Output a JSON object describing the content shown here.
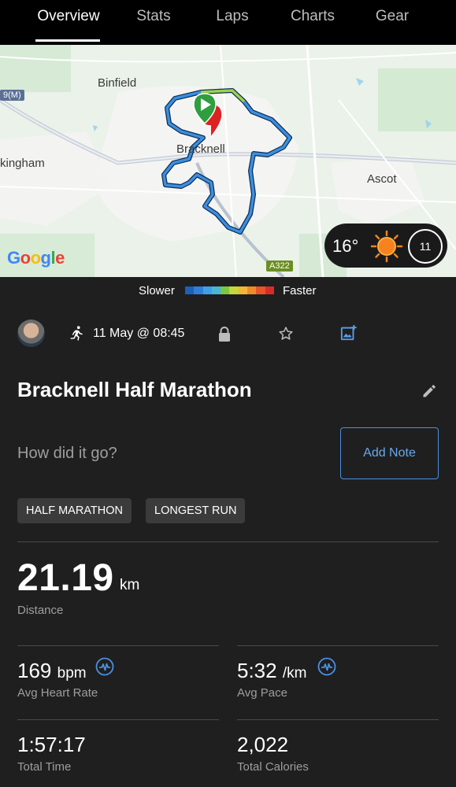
{
  "tabs": [
    {
      "label": "Overview",
      "active": true
    },
    {
      "label": "Stats",
      "active": false
    },
    {
      "label": "Laps",
      "active": false
    },
    {
      "label": "Charts",
      "active": false
    },
    {
      "label": "Gear",
      "active": false
    }
  ],
  "map": {
    "places": {
      "binfield": "Binfield",
      "bracknell": "Bracknell",
      "wokingham": "kingham",
      "ascot": "Ascot",
      "road_m": "9(M)",
      "road_a322": "A322"
    },
    "google": {
      "g": "G",
      "o1": "o",
      "o2": "o",
      "g2": "g",
      "l": "l",
      "e": "e"
    },
    "weather": {
      "temperature": "16°",
      "wind": "11",
      "condition_icon": "sun-icon"
    }
  },
  "legend": {
    "slower": "Slower",
    "faster": "Faster",
    "colors": [
      "#1e5fb8",
      "#2f7fd6",
      "#3fa0e8",
      "#48b6d8",
      "#7ac943",
      "#c8d63a",
      "#f2b736",
      "#f08a2a",
      "#e8542a",
      "#d92b2b"
    ]
  },
  "activity": {
    "type_icon": "running-icon",
    "datetime": "11 May @ 08:45",
    "title": "Bracknell Half Marathon",
    "note_prompt": "How did it go?",
    "add_note_label": "Add Note",
    "tags": [
      "HALF MARATHON",
      "LONGEST RUN"
    ]
  },
  "stats": {
    "distance": {
      "value": "21.19",
      "unit": "km",
      "label": "Distance"
    },
    "heart_rate": {
      "value": "169",
      "unit": "bpm",
      "label": "Avg Heart Rate"
    },
    "pace": {
      "value": "5:32",
      "unit": "/km",
      "label": "Avg Pace"
    },
    "time": {
      "value": "1:57:17",
      "label": "Total Time"
    },
    "calories": {
      "value": "2,022",
      "label": "Total Calories"
    }
  }
}
